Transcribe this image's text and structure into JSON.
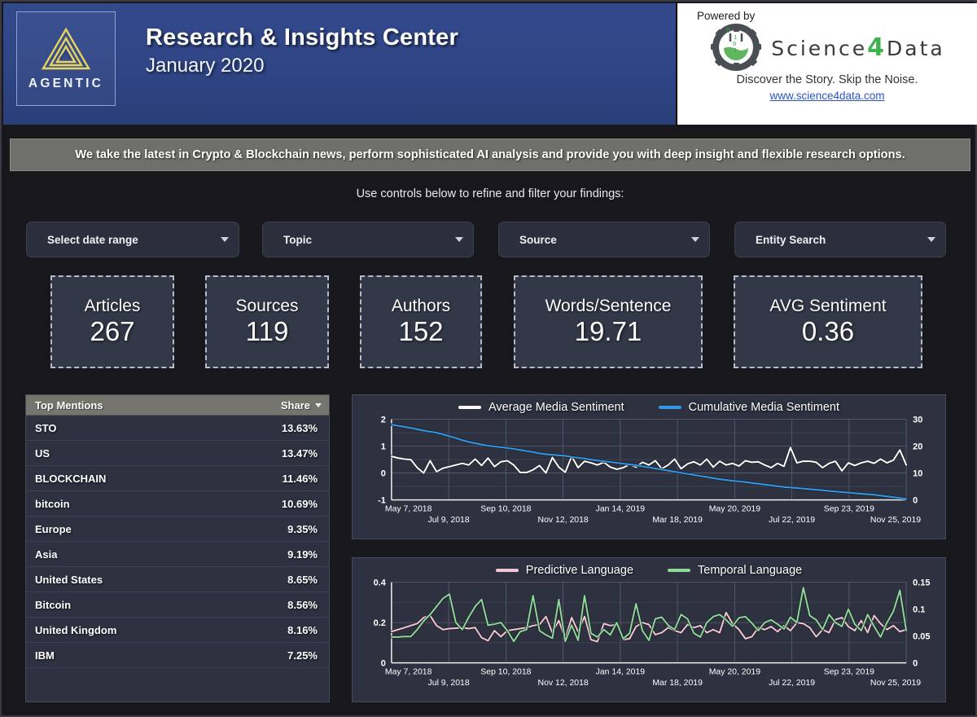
{
  "header": {
    "logo_word": "AGENTIC",
    "title": "Research & Insights Center",
    "subtitle": "January 2020",
    "powered_by": "Powered by",
    "brand_part1": "Science",
    "brand_four": "4",
    "brand_part2": "Data",
    "tagline": "Discover the Story. Skip the Noise.",
    "url": "www.science4data.com"
  },
  "banner": {
    "text": "We take the latest in Crypto & Blockchain news, perform sophisticated AI analysis and provide you with deep insight and flexible research options."
  },
  "controls_hint": "Use controls below to refine and filter your findings:",
  "filters": [
    {
      "label": "Select date range"
    },
    {
      "label": "Topic"
    },
    {
      "label": "Source"
    },
    {
      "label": "Entity Search"
    }
  ],
  "kpis": [
    {
      "label": "Articles",
      "value": "267"
    },
    {
      "label": "Sources",
      "value": "119"
    },
    {
      "label": "Authors",
      "value": "152"
    },
    {
      "label": "Words/Sentence",
      "value": "19.71"
    },
    {
      "label": "AVG Sentiment",
      "value": "0.36"
    }
  ],
  "table": {
    "col_name": "Top Mentions",
    "col_value": "Share",
    "rows": [
      {
        "name": "STO",
        "value": "13.63%"
      },
      {
        "name": "US",
        "value": "13.47%"
      },
      {
        "name": "BLOCKCHAIN",
        "value": "11.46%"
      },
      {
        "name": "bitcoin",
        "value": "10.69%"
      },
      {
        "name": "Europe",
        "value": "9.35%"
      },
      {
        "name": "Asia",
        "value": "9.19%"
      },
      {
        "name": "United States",
        "value": "8.65%"
      },
      {
        "name": "Bitcoin",
        "value": "8.56%"
      },
      {
        "name": "United Kingdom",
        "value": "8.16%"
      },
      {
        "name": "IBM",
        "value": "7.25%"
      }
    ]
  },
  "colors": {
    "accent_blue": "#2f4585",
    "brand_green": "#3fb34f",
    "logo_gold": "#e8d45c",
    "series_white": "#ffffff",
    "series_blue": "#3399e6",
    "series_pink": "#f2c6d2",
    "series_green": "#8fd89a"
  },
  "chart_data": [
    {
      "type": "line",
      "title": "",
      "legend": [
        {
          "name": "Average Media Sentiment",
          "color": "#ffffff",
          "axis": "left"
        },
        {
          "name": "Cumulative Media Sentiment",
          "color": "#3399e6",
          "axis": "right"
        }
      ],
      "legend_position": "top-center",
      "grid": true,
      "xlabel": "",
      "ylabel": "",
      "ylim": [
        -1,
        2
      ],
      "yticks": [
        "2",
        "1",
        "0",
        "-1"
      ],
      "y2lim": [
        0,
        30
      ],
      "y2ticks": [
        "30",
        "20",
        "10",
        "0"
      ],
      "xticks": [
        "May 7, 2018",
        "Jul 9, 2018",
        "Sep 10, 2018",
        "Nov 12, 2018",
        "Jan 14, 2019",
        "Mar 18, 2019",
        "May 20, 2019",
        "Jul 22, 2019",
        "Sep 23, 2019",
        "Nov 25, 2019"
      ],
      "series": [
        {
          "name": "Average Media Sentiment",
          "axis": "left",
          "values": [
            0.62,
            0.56,
            0.52,
            0.5,
            0.2,
            0.0,
            0.46,
            0.05,
            0.18,
            0.24,
            0.3,
            0.36,
            0.3,
            0.52,
            0.28,
            0.56,
            0.24,
            0.42,
            0.46,
            0.3,
            0.02,
            0.02,
            0.12,
            0.28,
            0.0,
            0.58,
            0.22,
            0.03,
            0.62,
            0.2,
            0.44,
            0.38,
            0.3,
            0.4,
            0.22,
            0.14,
            0.2,
            0.32,
            0.22,
            0.4,
            0.3,
            0.46,
            0.16,
            0.3,
            0.52,
            0.16,
            0.34,
            0.42,
            0.3,
            0.52,
            0.22,
            0.44,
            0.3,
            0.36,
            0.26,
            0.46,
            0.4,
            0.42,
            0.3,
            0.2,
            0.36,
            0.25,
            0.95,
            0.38,
            0.44,
            0.44,
            0.4,
            0.2,
            0.36,
            0.44,
            0.08,
            0.38,
            0.28,
            0.38,
            0.44,
            0.36,
            0.52,
            0.38,
            0.48,
            0.86,
            0.3
          ]
        },
        {
          "name": "Cumulative Media Sentiment",
          "axis": "right",
          "values": [
            28.0,
            27.6,
            27.2,
            26.8,
            26.3,
            25.8,
            25.4,
            25.0,
            24.4,
            23.7,
            23.0,
            22.2,
            21.6,
            21.1,
            20.6,
            20.2,
            19.9,
            19.6,
            19.3,
            19.0,
            18.6,
            18.2,
            17.8,
            17.3,
            17.0,
            16.8,
            16.6,
            16.4,
            16.0,
            15.7,
            15.4,
            15.0,
            14.7,
            14.4,
            14.1,
            13.8,
            13.5,
            13.2,
            12.9,
            12.5,
            12.1,
            11.7,
            11.3,
            10.9,
            10.5,
            10.1,
            9.7,
            9.3,
            8.9,
            8.5,
            8.1,
            7.7,
            7.4,
            7.1,
            6.9,
            6.6,
            6.3,
            6.0,
            5.7,
            5.4,
            5.1,
            4.8,
            4.6,
            4.4,
            4.2,
            4.0,
            3.8,
            3.6,
            3.3,
            3.1,
            2.9,
            2.7,
            2.5,
            2.3,
            2.1,
            1.9,
            1.6,
            1.3,
            1.0,
            0.7,
            0.4
          ]
        }
      ]
    },
    {
      "type": "line",
      "title": "",
      "legend": [
        {
          "name": "Predictive Language",
          "color": "#f2c6d2",
          "axis": "left"
        },
        {
          "name": "Temporal Language",
          "color": "#8fd89a",
          "axis": "right"
        }
      ],
      "legend_position": "top-center",
      "grid": true,
      "xlabel": "",
      "ylabel": "",
      "ylim": [
        0,
        0.4
      ],
      "yticks": [
        "0.4",
        "0.2",
        "0"
      ],
      "y2lim": [
        0,
        0.15
      ],
      "y2ticks": [
        "0.15",
        "0.1",
        "0.05",
        "0"
      ],
      "xticks": [
        "May 7, 2018",
        "Jul 9, 2018",
        "Sep 10, 2018",
        "Nov 12, 2018",
        "Jan 14, 2019",
        "Mar 18, 2019",
        "May 20, 2019",
        "Jul 22, 2019",
        "Sep 23, 2019",
        "Nov 25, 2019"
      ],
      "series": [
        {
          "name": "Predictive Language",
          "axis": "left",
          "values": [
            0.155,
            0.165,
            0.175,
            0.185,
            0.195,
            0.225,
            0.235,
            0.185,
            0.165,
            0.17,
            0.172,
            0.175,
            0.17,
            0.175,
            0.125,
            0.11,
            0.16,
            0.13,
            0.16,
            0.165,
            0.17,
            0.175,
            0.185,
            0.19,
            0.23,
            0.15,
            0.21,
            0.12,
            0.225,
            0.155,
            0.23,
            0.115,
            0.105,
            0.195,
            0.185,
            0.19,
            0.115,
            0.12,
            0.18,
            0.2,
            0.19,
            0.14,
            0.15,
            0.175,
            0.16,
            0.15,
            0.19,
            0.175,
            0.185,
            0.15,
            0.165,
            0.15,
            0.25,
            0.195,
            0.165,
            0.12,
            0.13,
            0.175,
            0.165,
            0.18,
            0.155,
            0.185,
            0.16,
            0.2,
            0.195,
            0.175,
            0.13,
            0.165,
            0.15,
            0.215,
            0.225,
            0.18,
            0.16,
            0.21,
            0.15,
            0.235,
            0.195,
            0.165,
            0.185,
            0.155,
            0.165
          ]
        },
        {
          "name": "Temporal Language",
          "axis": "right",
          "values": [
            0.048,
            0.048,
            0.049,
            0.049,
            0.062,
            0.078,
            0.09,
            0.105,
            0.12,
            0.128,
            0.075,
            0.062,
            0.085,
            0.105,
            0.118,
            0.07,
            0.072,
            0.075,
            0.06,
            0.04,
            0.058,
            0.062,
            0.125,
            0.06,
            0.052,
            0.046,
            0.118,
            0.04,
            0.07,
            0.042,
            0.125,
            0.055,
            0.048,
            0.062,
            0.052,
            0.075,
            0.045,
            0.055,
            0.11,
            0.06,
            0.042,
            0.082,
            0.085,
            0.07,
            0.062,
            0.09,
            0.082,
            0.055,
            0.048,
            0.075,
            0.086,
            0.09,
            0.08,
            0.068,
            0.084,
            0.086,
            0.074,
            0.06,
            0.075,
            0.08,
            0.072,
            0.063,
            0.085,
            0.075,
            0.14,
            0.088,
            0.08,
            0.062,
            0.09,
            0.075,
            0.068,
            0.1,
            0.072,
            0.06,
            0.09,
            0.068,
            0.048,
            0.075,
            0.096,
            0.135,
            0.06
          ]
        }
      ]
    }
  ]
}
